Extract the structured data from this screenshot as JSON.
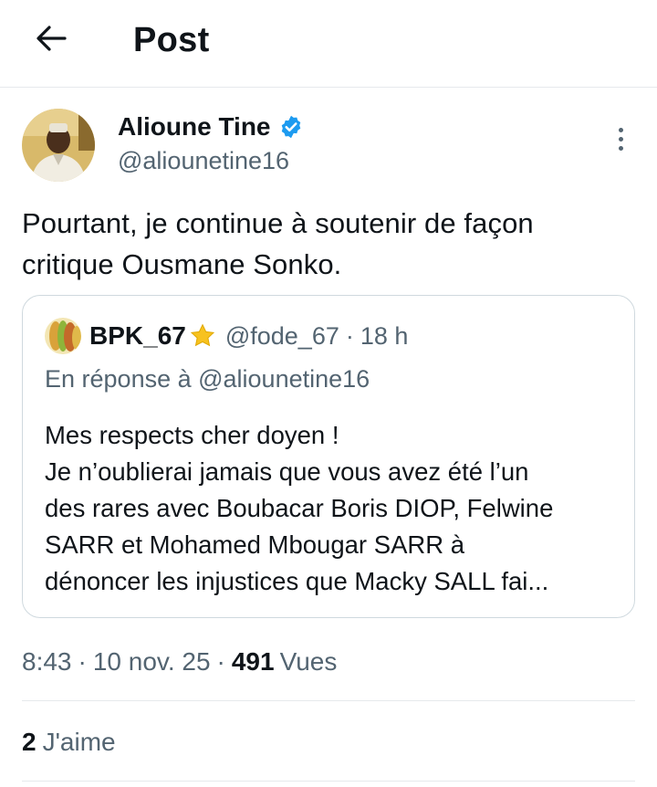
{
  "header": {
    "title": "Post",
    "back_icon": "arrow-left-icon"
  },
  "post": {
    "author_name": "Alioune Tine",
    "author_handle": "@aliounetine16",
    "verified": true,
    "text_lines": [
      "Pourtant, je continue à soutenir de façon",
      "critique Ousmane Sonko."
    ],
    "time": "8:43",
    "date": "10 nov. 25",
    "separator": "·",
    "views_count": "491",
    "views_label": "Vues",
    "likes_count": "2",
    "likes_label": "J'aime"
  },
  "quote": {
    "name": "BPK_67",
    "star": "⭐",
    "handle": "@fode_67",
    "separator": "·",
    "time": "18 h",
    "reply_to": "En réponse à @aliounetine16",
    "lines": [
      "Mes respects cher doyen !",
      "Je n’oublierai jamais que vous avez été l’un",
      "des rares avec Boubacar Boris DIOP, Felwine",
      "SARR et Mohamed Mbougar SARR à",
      "dénoncer les injustices que Macky SALL fai..."
    ]
  },
  "colors": {
    "text": "#0f1419",
    "secondary": "#536471",
    "verified": "#1d9bf0",
    "border": "#cfd9de"
  }
}
